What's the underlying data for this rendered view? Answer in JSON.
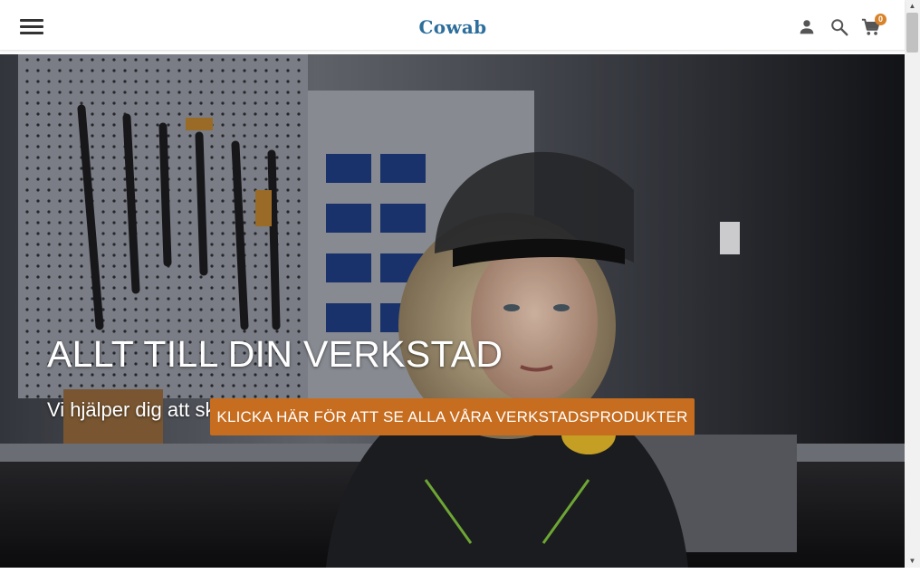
{
  "header": {
    "logo_text": "Cowab",
    "menu_icon": "hamburger-menu-icon",
    "account_icon": "user-icon",
    "search_icon": "search-icon",
    "cart_icon": "cart-icon",
    "cart_count": "0"
  },
  "hero": {
    "title": "ALLT TILL DIN VERKSTAD",
    "subtitle": "Vi hjälper dig att skapa en effektiv verkstadsmiljö",
    "cta_label": "KLICKA HÄR FÖR ATT SE ALLA VÅRA VERKSTADSPRODUKTER",
    "image_subject": "Worker with welding visor in a workshop with tool wall"
  },
  "colors": {
    "brand": "#2c6e9c",
    "accent": "#c76d1f",
    "badge": "#d8822a"
  }
}
